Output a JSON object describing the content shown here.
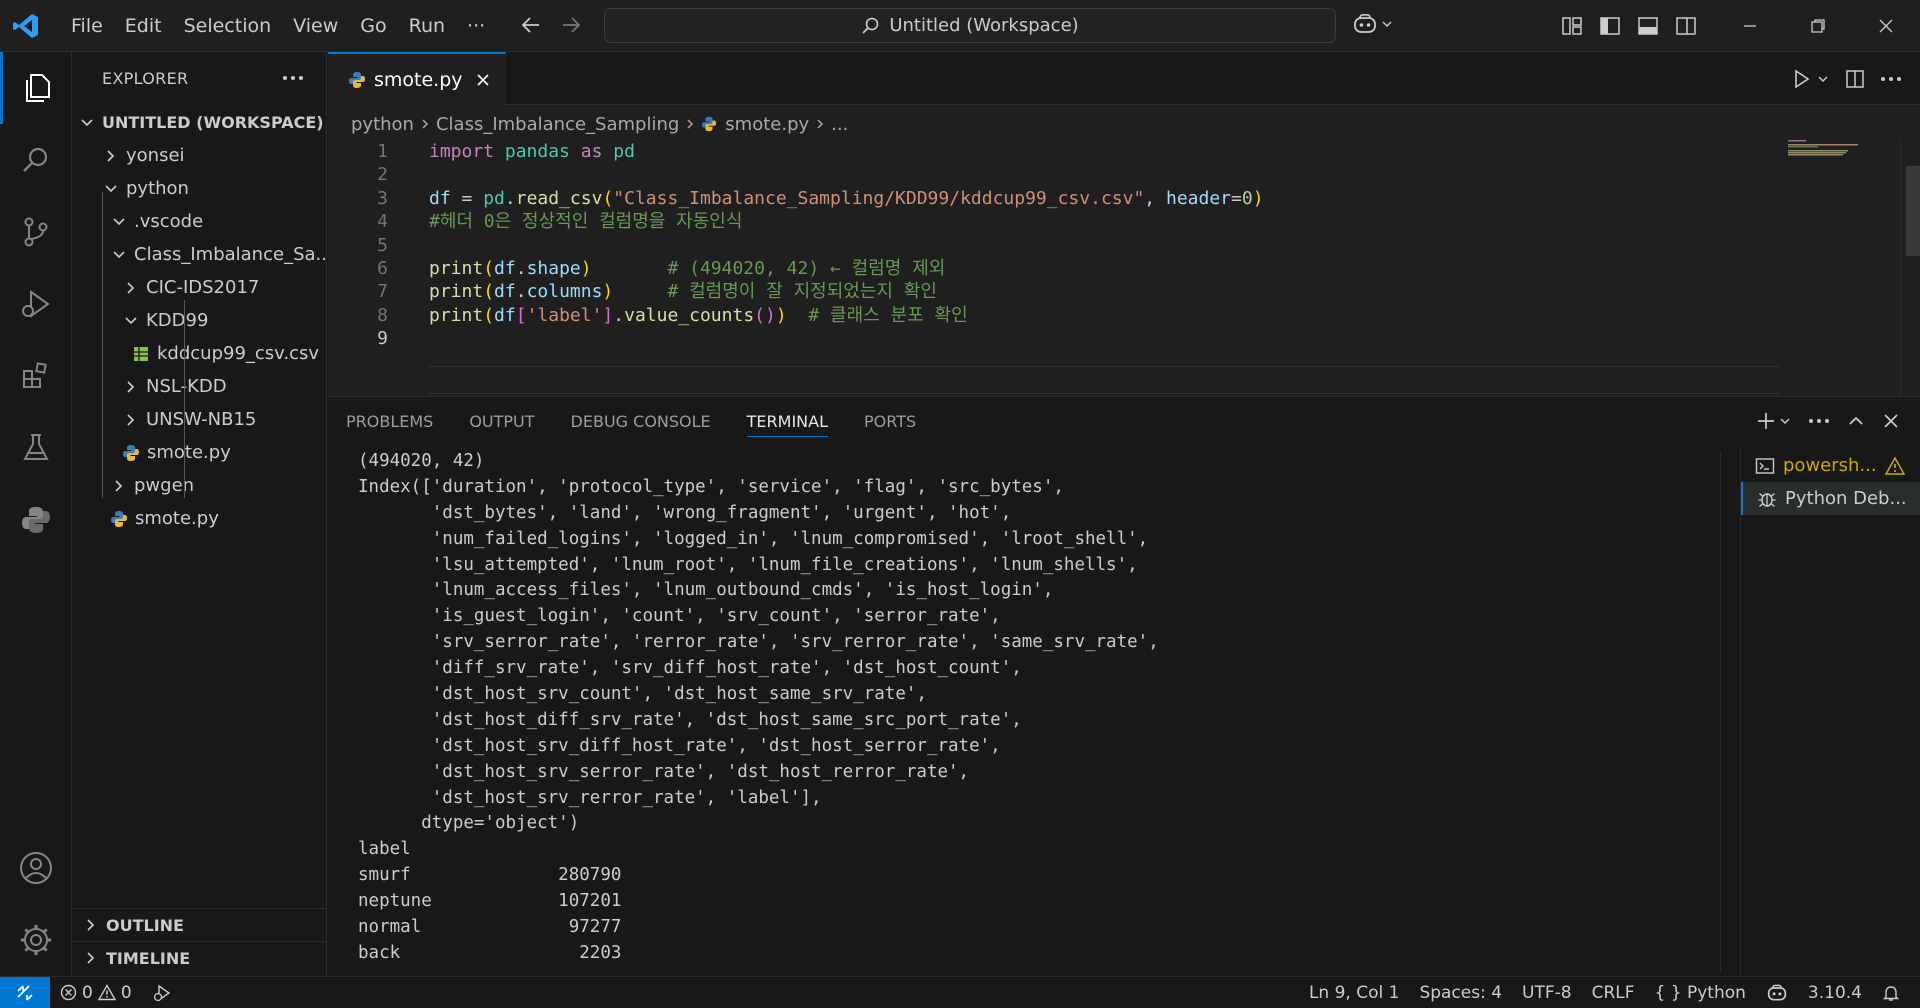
{
  "titlebar": {
    "menu": [
      "File",
      "Edit",
      "Selection",
      "View",
      "Go",
      "Run",
      "···"
    ],
    "search_text": "Untitled (Workspace)"
  },
  "sidebar": {
    "title": "EXPLORER",
    "workspace": "UNTITLED (WORKSPACE)",
    "items": [
      {
        "label": "yonsei",
        "depth": 0,
        "kind": "folder",
        "open": false
      },
      {
        "label": "python",
        "depth": 0,
        "kind": "folder",
        "open": true
      },
      {
        "label": ".vscode",
        "depth": 1,
        "kind": "folder",
        "open": true
      },
      {
        "label": "Class_Imbalance_Sa...",
        "depth": 1,
        "kind": "folder",
        "open": true
      },
      {
        "label": "CIC-IDS2017",
        "depth": 2,
        "kind": "folder",
        "open": false
      },
      {
        "label": "KDD99",
        "depth": 2,
        "kind": "folder",
        "open": true
      },
      {
        "label": "kddcup99_csv.csv",
        "depth": 3,
        "kind": "csv"
      },
      {
        "label": "NSL-KDD",
        "depth": 2,
        "kind": "folder",
        "open": false
      },
      {
        "label": "UNSW-NB15",
        "depth": 2,
        "kind": "folder",
        "open": false
      },
      {
        "label": "smote.py",
        "depth": 2,
        "kind": "py"
      },
      {
        "label": "pwgen",
        "depth": 1,
        "kind": "folder",
        "open": false
      },
      {
        "label": "smote.py",
        "depth": 1,
        "kind": "py"
      }
    ],
    "outline": "OUTLINE",
    "timeline": "TIMELINE"
  },
  "editor": {
    "tab_label": "smote.py",
    "breadcrumb": [
      "python",
      "Class_Imbalance_Sampling",
      "smote.py",
      "..."
    ],
    "lines": [
      {
        "n": "1",
        "tokens": [
          [
            "kw",
            "import"
          ],
          [
            "",
            ""
          ],
          [
            "mod",
            " pandas"
          ],
          [
            "kw",
            " as"
          ],
          [
            "mod",
            " pd"
          ]
        ]
      },
      {
        "n": "2",
        "tokens": []
      },
      {
        "n": "3",
        "tokens": [
          [
            "var",
            "df"
          ],
          [
            "",
            " = "
          ],
          [
            "mod",
            "pd"
          ],
          [
            "",
            "."
          ],
          [
            "fn",
            "read_csv"
          ],
          [
            "br",
            "("
          ],
          [
            "str",
            "\"Class_Imbalance_Sampling/KDD99/kddcup99_csv.csv\""
          ],
          [
            "",
            ", "
          ],
          [
            "var",
            "header"
          ],
          [
            "",
            "="
          ],
          [
            "num",
            "0"
          ],
          [
            "br",
            ")"
          ]
        ]
      },
      {
        "n": "4",
        "tokens": [
          [
            "cm",
            "#헤더 0은 정상적인 컬럼명을 자동인식"
          ]
        ]
      },
      {
        "n": "5",
        "tokens": []
      },
      {
        "n": "6",
        "tokens": [
          [
            "fn",
            "print"
          ],
          [
            "br",
            "("
          ],
          [
            "var",
            "df"
          ],
          [
            "",
            "."
          ],
          [
            "var",
            "shape"
          ],
          [
            "br",
            ")"
          ],
          [
            "",
            "       "
          ],
          [
            "cm",
            "# (494020, 42) ← 컬럼명 제외"
          ]
        ]
      },
      {
        "n": "7",
        "tokens": [
          [
            "fn",
            "print"
          ],
          [
            "br",
            "("
          ],
          [
            "var",
            "df"
          ],
          [
            "",
            "."
          ],
          [
            "var",
            "columns"
          ],
          [
            "br",
            ")"
          ],
          [
            "",
            "     "
          ],
          [
            "cm",
            "# 컬럼명이 잘 지정되었는지 확인"
          ]
        ]
      },
      {
        "n": "8",
        "tokens": [
          [
            "fn",
            "print"
          ],
          [
            "br",
            "("
          ],
          [
            "var",
            "df"
          ],
          [
            "br2",
            "["
          ],
          [
            "str",
            "'label'"
          ],
          [
            "br2",
            "]"
          ],
          [
            "",
            "."
          ],
          [
            "fn",
            "value_counts"
          ],
          [
            "br2",
            "()"
          ],
          [
            "br",
            ")"
          ],
          [
            "",
            "  "
          ],
          [
            "cm",
            "# 클래스 분포 확인"
          ]
        ]
      },
      {
        "n": "9",
        "tokens": []
      }
    ]
  },
  "panel": {
    "tabs": [
      "PROBLEMS",
      "OUTPUT",
      "DEBUG CONSOLE",
      "TERMINAL",
      "PORTS"
    ],
    "active_tab": "TERMINAL",
    "terminal_lines": [
      "(494020, 42)",
      "Index(['duration', 'protocol_type', 'service', 'flag', 'src_bytes',",
      "       'dst_bytes', 'land', 'wrong_fragment', 'urgent', 'hot',",
      "       'num_failed_logins', 'logged_in', 'lnum_compromised', 'lroot_shell',",
      "       'lsu_attempted', 'lnum_root', 'lnum_file_creations', 'lnum_shells',",
      "       'lnum_access_files', 'lnum_outbound_cmds', 'is_host_login',",
      "       'is_guest_login', 'count', 'srv_count', 'serror_rate',",
      "       'srv_serror_rate', 'rerror_rate', 'srv_rerror_rate', 'same_srv_rate',",
      "       'diff_srv_rate', 'srv_diff_host_rate', 'dst_host_count',",
      "       'dst_host_srv_count', 'dst_host_same_srv_rate',",
      "       'dst_host_diff_srv_rate', 'dst_host_same_src_port_rate',",
      "       'dst_host_srv_diff_host_rate', 'dst_host_serror_rate',",
      "       'dst_host_srv_serror_rate', 'dst_host_rerror_rate',",
      "       'dst_host_srv_rerror_rate', 'label'],",
      "      dtype='object')",
      "label",
      "smurf              280790",
      "neptune            107201",
      "normal              97277",
      "back                 2203"
    ],
    "terminals": [
      {
        "label": "powersh...",
        "warning": true
      },
      {
        "label": "Python Deb...",
        "active": true
      }
    ]
  },
  "statusbar": {
    "errors": "0",
    "warnings": "0",
    "position": "Ln 9, Col 1",
    "spaces": "Spaces: 4",
    "encoding": "UTF-8",
    "eol": "CRLF",
    "language": "{ } Python",
    "version": "3.10.4"
  },
  "colors": {
    "accent": "#0078d4",
    "keyword": "#c586c0",
    "string": "#ce9178",
    "comment": "#6a9955",
    "function": "#dcdcaa",
    "variable": "#9cdcfe"
  }
}
